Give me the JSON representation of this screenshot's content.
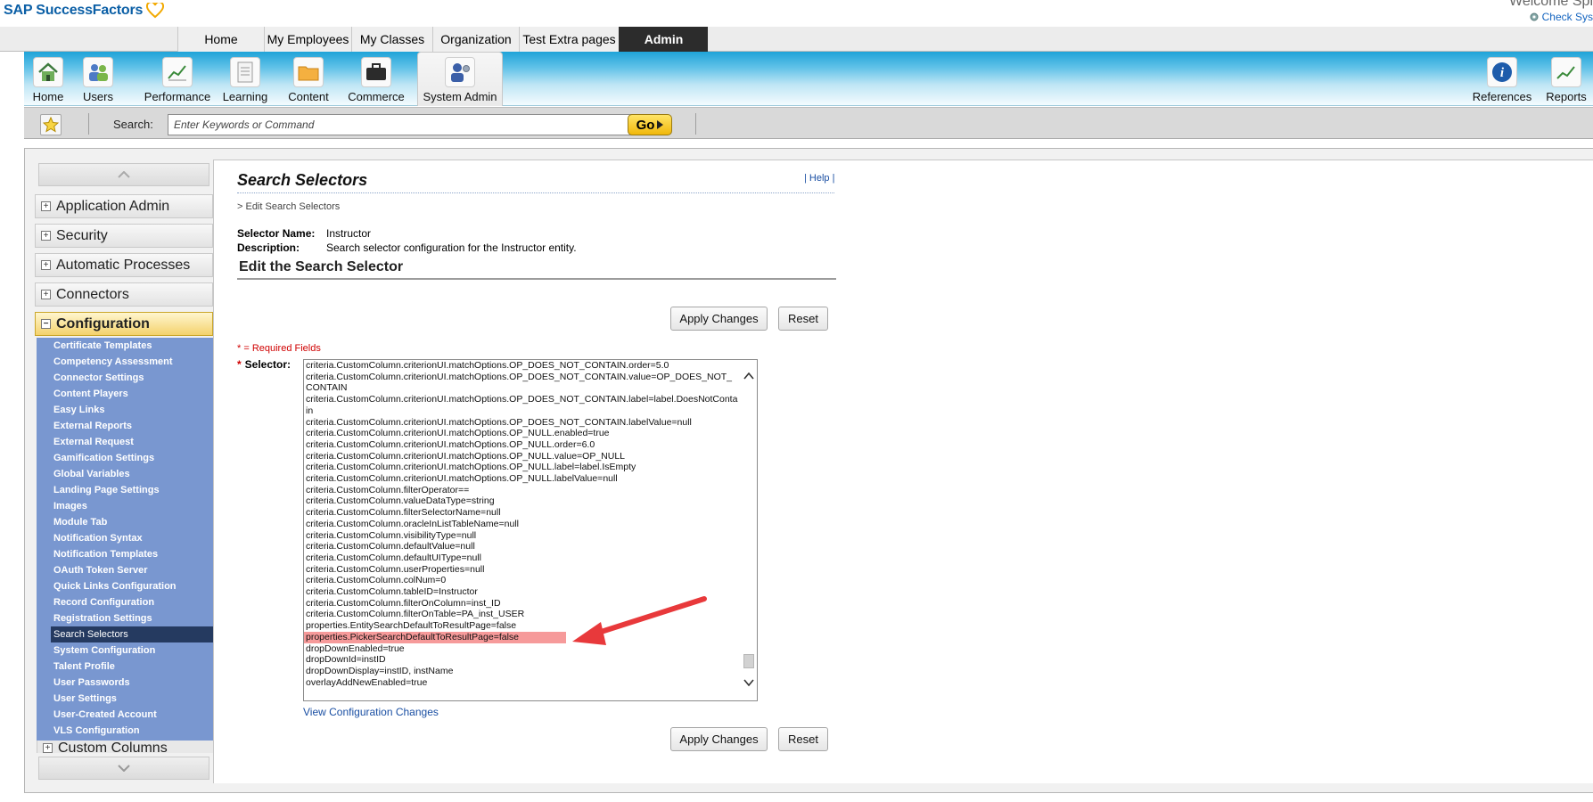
{
  "brand": {
    "name": "SAP SuccessFactors"
  },
  "header": {
    "welcome": "Welcome Spi",
    "check_system": "Check Sys"
  },
  "topnav": {
    "tabs": [
      {
        "label": "Home"
      },
      {
        "label": "My Employees"
      },
      {
        "label": "My Classes"
      },
      {
        "label": "Organization"
      },
      {
        "label": "Test Extra pages"
      },
      {
        "label": "Admin"
      }
    ],
    "active": "Admin"
  },
  "iconbar": {
    "items": [
      {
        "label": "Home",
        "icon": "house-icon"
      },
      {
        "label": "Users",
        "icon": "users-icon"
      },
      {
        "label": "Performance",
        "icon": "performance-chart-icon"
      },
      {
        "label": "Learning",
        "icon": "document-icon"
      },
      {
        "label": "Content",
        "icon": "folder-icon"
      },
      {
        "label": "Commerce",
        "icon": "briefcase-icon"
      },
      {
        "label": "System Admin",
        "icon": "admin-user-icon"
      }
    ],
    "right_items": [
      {
        "label": "References",
        "icon": "info-icon"
      },
      {
        "label": "Reports",
        "icon": "report-chart-icon"
      }
    ],
    "active": "System Admin"
  },
  "search": {
    "label": "Search:",
    "placeholder": "Enter Keywords or Command",
    "go_label": "Go"
  },
  "sidebar": {
    "groups": [
      {
        "label": "Application Admin",
        "expanded": false
      },
      {
        "label": "Security",
        "expanded": false
      },
      {
        "label": "Automatic Processes",
        "expanded": false
      },
      {
        "label": "Connectors",
        "expanded": false
      },
      {
        "label": "Configuration",
        "expanded": true
      }
    ],
    "items": [
      "Certificate Templates",
      "Competency Assessment",
      "Connector Settings",
      "Content Players",
      "Easy Links",
      "External Reports",
      "External Request",
      "Gamification Settings",
      "Global Variables",
      "Landing Page Settings",
      "Images",
      "Module Tab",
      "Notification Syntax",
      "Notification Templates",
      "OAuth Token Server",
      "Quick Links Configuration",
      "Record Configuration",
      "Registration Settings",
      "Search Selectors",
      "System Configuration",
      "Talent Profile",
      "User Passwords",
      "User Settings",
      "User-Created Account",
      "VLS Configuration"
    ],
    "active_item": "Search Selectors",
    "clipped_group": "Custom Columns"
  },
  "main": {
    "title": "Search Selectors",
    "help": "| Help |",
    "breadcrumb": "> Edit Search Selectors",
    "selector_name_label": "Selector Name:",
    "selector_name": "Instructor",
    "description_label": "Description:",
    "description": "Search selector configuration for the Instructor entity.",
    "section_title": "Edit the Search Selector",
    "apply_label": "Apply Changes",
    "reset_label": "Reset",
    "required_note": "* = Required Fields",
    "selector_label": "Selector:",
    "view_changes": "View Configuration Changes",
    "selector_lines": [
      "criteria.CustomColumn.criterionUI.matchOptions.OP_DOES_NOT_CONTAIN.order=5.0",
      "criteria.CustomColumn.criterionUI.matchOptions.OP_DOES_NOT_CONTAIN.value=OP_DOES_NOT_CONTAIN",
      "criteria.CustomColumn.criterionUI.matchOptions.OP_DOES_NOT_CONTAIN.label=label.DoesNotContain",
      "criteria.CustomColumn.criterionUI.matchOptions.OP_DOES_NOT_CONTAIN.labelValue=null",
      "criteria.CustomColumn.criterionUI.matchOptions.OP_NULL.enabled=true",
      "criteria.CustomColumn.criterionUI.matchOptions.OP_NULL.order=6.0",
      "criteria.CustomColumn.criterionUI.matchOptions.OP_NULL.value=OP_NULL",
      "criteria.CustomColumn.criterionUI.matchOptions.OP_NULL.label=label.IsEmpty",
      "criteria.CustomColumn.criterionUI.matchOptions.OP_NULL.labelValue=null",
      "criteria.CustomColumn.filterOperator==",
      "criteria.CustomColumn.valueDataType=string",
      "criteria.CustomColumn.filterSelectorName=null",
      "criteria.CustomColumn.oracleInListTableName=null",
      "criteria.CustomColumn.visibilityType=null",
      "criteria.CustomColumn.defaultValue=null",
      "criteria.CustomColumn.defaultUIType=null",
      "criteria.CustomColumn.userProperties=null",
      "criteria.CustomColumn.colNum=0",
      "criteria.CustomColumn.tableID=Instructor",
      "criteria.CustomColumn.filterOnColumn=inst_ID",
      "criteria.CustomColumn.filterOnTable=PA_inst_USER",
      "properties.EntitySearchDefaultToResultPage=false",
      "properties.PickerSearchDefaultToResultPage=false",
      "dropDownEnabled=true",
      "dropDownId=instID",
      "dropDownDisplay=instID, instName",
      "overlayAddNewEnabled=true"
    ],
    "highlighted_line": "properties.PickerSearchDefaultToResultPage=false"
  },
  "colors": {
    "accent_blue": "#1fa3d8",
    "admin_tab": "#2c2c2c",
    "sidebar_list": "#7997d0",
    "sidebar_active": "#253a60",
    "highlight": "#f69a9a",
    "annotation_arrow": "#e8393b",
    "go_button": "#f1b80b"
  }
}
